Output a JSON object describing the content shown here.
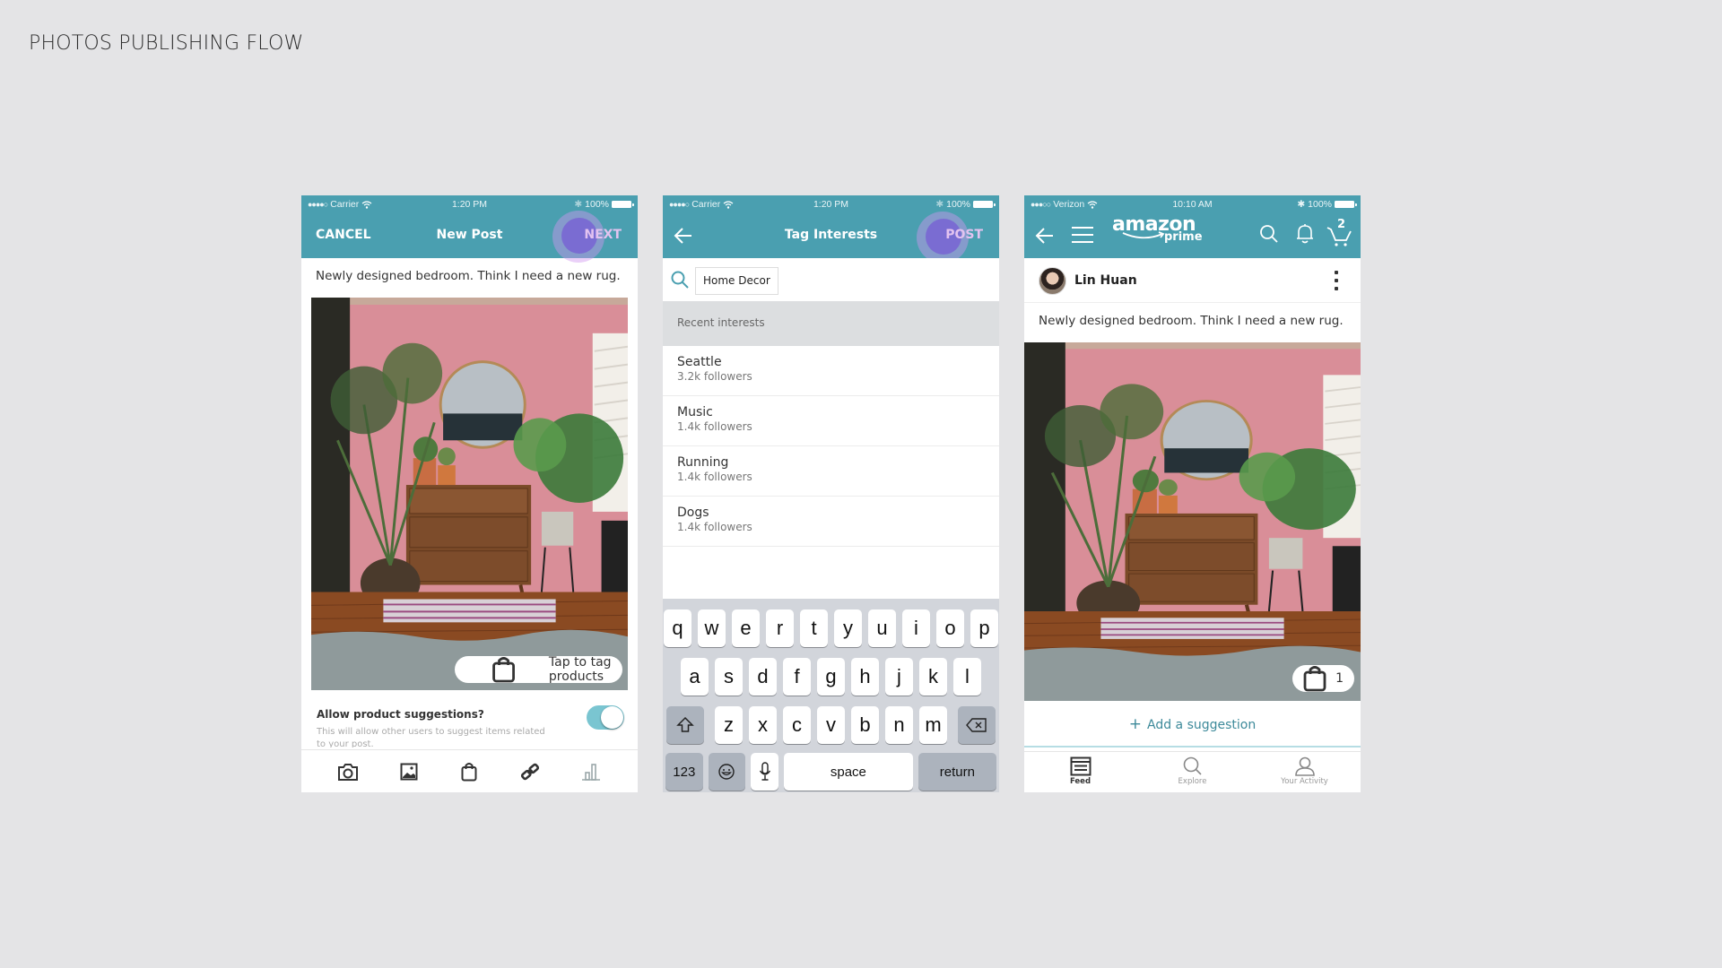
{
  "page": {
    "title": "PHOTOS PUBLISHING FLOW"
  },
  "colors": {
    "appbar": "#4a9fb0",
    "accent_link": "#3d8a9a",
    "toggle_on": "#7ac5d1",
    "touch_indicator": "#9a6fe0"
  },
  "screen1": {
    "status": {
      "carrier": "Carrier",
      "time": "1:20 PM",
      "battery": "100%"
    },
    "nav": {
      "cancel": "CANCEL",
      "title": "New Post",
      "next": "NEXT"
    },
    "caption": "Newly designed bedroom. Think I need a new rug.",
    "photo_tag_button": "Tap to tag products",
    "allow_suggestions": {
      "title": "Allow product suggestions?",
      "description": "This will allow other users to suggest items related to your post.",
      "enabled": true
    },
    "toolbar": [
      {
        "icon": "camera-icon"
      },
      {
        "icon": "image-icon"
      },
      {
        "icon": "shopping-bag-icon"
      },
      {
        "icon": "link-icon"
      },
      {
        "icon": "bar-chart-icon"
      }
    ]
  },
  "screen2": {
    "status": {
      "carrier": "Carrier",
      "time": "1:20 PM",
      "battery": "100%"
    },
    "nav": {
      "title": "Tag Interests",
      "post": "POST"
    },
    "search": {
      "value": "Home Decor"
    },
    "section_header": "Recent interests",
    "interests": [
      {
        "name": "Seattle",
        "followers": "3.2k followers"
      },
      {
        "name": "Music",
        "followers": "1.4k followers"
      },
      {
        "name": "Running",
        "followers": "1.4k followers"
      },
      {
        "name": "Dogs",
        "followers": "1.4k followers"
      }
    ],
    "keyboard": {
      "row1": [
        "q",
        "w",
        "e",
        "r",
        "t",
        "y",
        "u",
        "i",
        "o",
        "p"
      ],
      "row2": [
        "a",
        "s",
        "d",
        "f",
        "g",
        "h",
        "j",
        "k",
        "l"
      ],
      "row3": [
        "z",
        "x",
        "c",
        "v",
        "b",
        "n",
        "m"
      ],
      "numbers": "123",
      "space": "space",
      "return": "return"
    }
  },
  "screen3": {
    "status": {
      "carrier": "Verizon",
      "time": "10:10 AM",
      "battery": "100%"
    },
    "brand": {
      "name": "amazon",
      "sub": "prime"
    },
    "cart_count": "2",
    "user": {
      "name": "Lin Huan"
    },
    "caption": "Newly designed bedroom. Think I need a new rug.",
    "tagged_count": "1",
    "add_suggestion": "Add a suggestion",
    "tabs": [
      {
        "label": "Feed",
        "active": true
      },
      {
        "label": "Explore",
        "active": false
      },
      {
        "label": "Your Activity",
        "active": false
      }
    ]
  }
}
